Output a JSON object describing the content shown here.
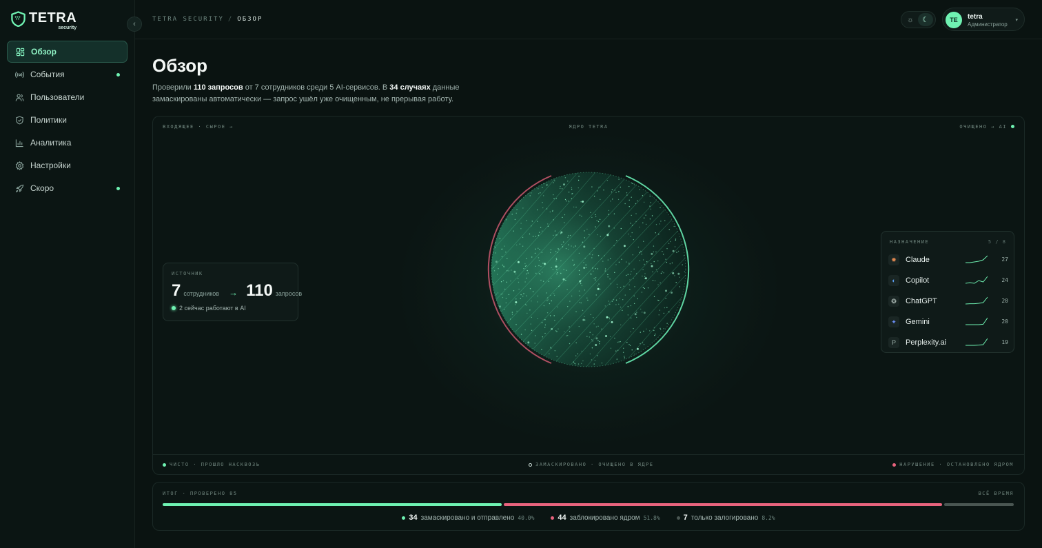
{
  "brand": {
    "name": "TETRA",
    "sub": "security"
  },
  "sidebar": {
    "items": [
      {
        "label": "Обзор",
        "icon": "grid-icon",
        "active": true,
        "dot": false
      },
      {
        "label": "События",
        "icon": "broadcast-icon",
        "active": false,
        "dot": true
      },
      {
        "label": "Пользователи",
        "icon": "users-icon",
        "active": false,
        "dot": false
      },
      {
        "label": "Политики",
        "icon": "shield-check-icon",
        "active": false,
        "dot": false
      },
      {
        "label": "Аналитика",
        "icon": "bar-chart-icon",
        "active": false,
        "dot": false
      },
      {
        "label": "Настройки",
        "icon": "gear-icon",
        "active": false,
        "dot": false
      },
      {
        "label": "Скоро",
        "icon": "rocket-icon",
        "active": false,
        "dot": true
      }
    ]
  },
  "header": {
    "breadcrumb_root": "TETRA SECURITY",
    "breadcrumb_sep": "/",
    "breadcrumb_current": "ОБЗОР",
    "user": {
      "initials": "TE",
      "name": "tetra",
      "role": "Администратор"
    }
  },
  "main": {
    "title": "Обзор",
    "summary": {
      "p1": "Проверили ",
      "requests": "110 запросов",
      "p2": " от 7 сотрудников среди 5 AI-сервисов. В ",
      "cases": "34 случаях",
      "p3": " данные замаскированы автоматически — запрос ушёл уже очищенным, не прерывая работу."
    }
  },
  "flow": {
    "head_left": "ВХОДЯЩЕЕ · СЫРОЕ →",
    "head_center": "ЯДРО TETRA",
    "head_right": "ОЧИЩЕНО → AI",
    "source": {
      "label": "ИСТОЧНИК",
      "employees": "7",
      "employees_unit": "сотрудников",
      "arrow": "→",
      "requests": "110",
      "requests_unit": "запросов",
      "live": "2 сейчас работают в AI"
    },
    "destinations": {
      "label": "НАЗНАЧЕНИЕ",
      "count": "5 / 8",
      "items": [
        {
          "name": "Claude",
          "value": "27",
          "icon": "claude-icon",
          "glyph": "✹",
          "color": "#e0874f",
          "spark": [
            1,
            1,
            1.5,
            2,
            3,
            6
          ]
        },
        {
          "name": "Copilot",
          "value": "24",
          "icon": "copilot-icon",
          "glyph": "◐",
          "color": "#5a9df0",
          "spark": [
            1,
            1.5,
            1,
            3,
            2,
            6
          ]
        },
        {
          "name": "ChatGPT",
          "value": "20",
          "icon": "chatgpt-icon",
          "glyph": "❂",
          "color": "#b9c7c2",
          "spark": [
            1,
            1.2,
            1.2,
            1.5,
            2,
            6
          ]
        },
        {
          "name": "Gemini",
          "value": "20",
          "icon": "gemini-icon",
          "glyph": "✦",
          "color": "#6a8ef5",
          "spark": [
            1,
            1,
            1,
            1,
            1.3,
            6
          ]
        },
        {
          "name": "Perplexity.ai",
          "value": "19",
          "icon": "perplexity-icon",
          "glyph": "P",
          "color": "#9fb3ad",
          "spark": [
            1,
            1,
            1,
            1.2,
            1.5,
            6
          ]
        }
      ]
    },
    "legend": {
      "clean": "ЧИСТО · ПРОШЛО НАСКВОЗЬ",
      "masked": "ЗАМАСКИРОВАНО · ОЧИЩЕНО В ЯДРЕ",
      "violation": "НАРУШЕНИЕ · ОСТАНОВЛЕНО ЯДРОМ"
    }
  },
  "totals": {
    "label": "ИТОГ · ПРОВЕРЕНО 85",
    "range": "ВСЁ ВРЕМЯ",
    "segments": [
      {
        "key": "masked",
        "value": 34,
        "label": "замаскировано и отправлено",
        "pct": "40.0%",
        "color": "#6ff2b2"
      },
      {
        "key": "blocked",
        "value": 44,
        "label": "заблокировано ядром",
        "pct": "51.8%",
        "color": "#e8637d"
      },
      {
        "key": "logged",
        "value": 7,
        "label": "только залогировано",
        "pct": "8.2%",
        "color": "#4a5652"
      }
    ]
  },
  "colors": {
    "accent": "#6ff2b2",
    "danger": "#e8637d",
    "background": "#0a1311"
  }
}
